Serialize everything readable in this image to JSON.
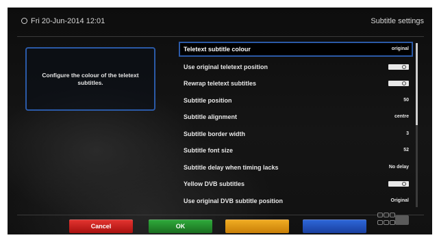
{
  "header": {
    "datetime": "Fri 20-Jun-2014 12:01",
    "title": "Subtitle settings"
  },
  "help_text": "Configure the colour of the teletext subtitles.",
  "settings": [
    {
      "label": "Teletext subtitle colour",
      "value": "original",
      "type": "text",
      "selected": true
    },
    {
      "label": "Use original teletext position",
      "value": "",
      "type": "toggle"
    },
    {
      "label": "Rewrap teletext subtitles",
      "value": "",
      "type": "toggle"
    },
    {
      "label": "Subtitle position",
      "value": "50",
      "type": "text"
    },
    {
      "label": "Subtitle alignment",
      "value": "centre",
      "type": "text"
    },
    {
      "label": "Subtitle border width",
      "value": "3",
      "type": "text"
    },
    {
      "label": "Subtitle font size",
      "value": "52",
      "type": "text"
    },
    {
      "label": "Subtitle delay when timing lacks",
      "value": "No delay",
      "type": "text"
    },
    {
      "label": "Yellow DVB subtitles",
      "value": "",
      "type": "toggle"
    },
    {
      "label": "Use original DVB subtitle position",
      "value": "Original",
      "type": "text"
    }
  ],
  "buttons": {
    "red": "Cancel",
    "green": "OK",
    "yellow": "",
    "blue": ""
  },
  "colors": {
    "accent_blue": "#2b5aa8",
    "red": "#c41f1c",
    "green": "#238a2c",
    "yellow": "#e09a15",
    "blue": "#2552bb"
  },
  "scroll": {
    "visible_fraction": 0.5
  }
}
